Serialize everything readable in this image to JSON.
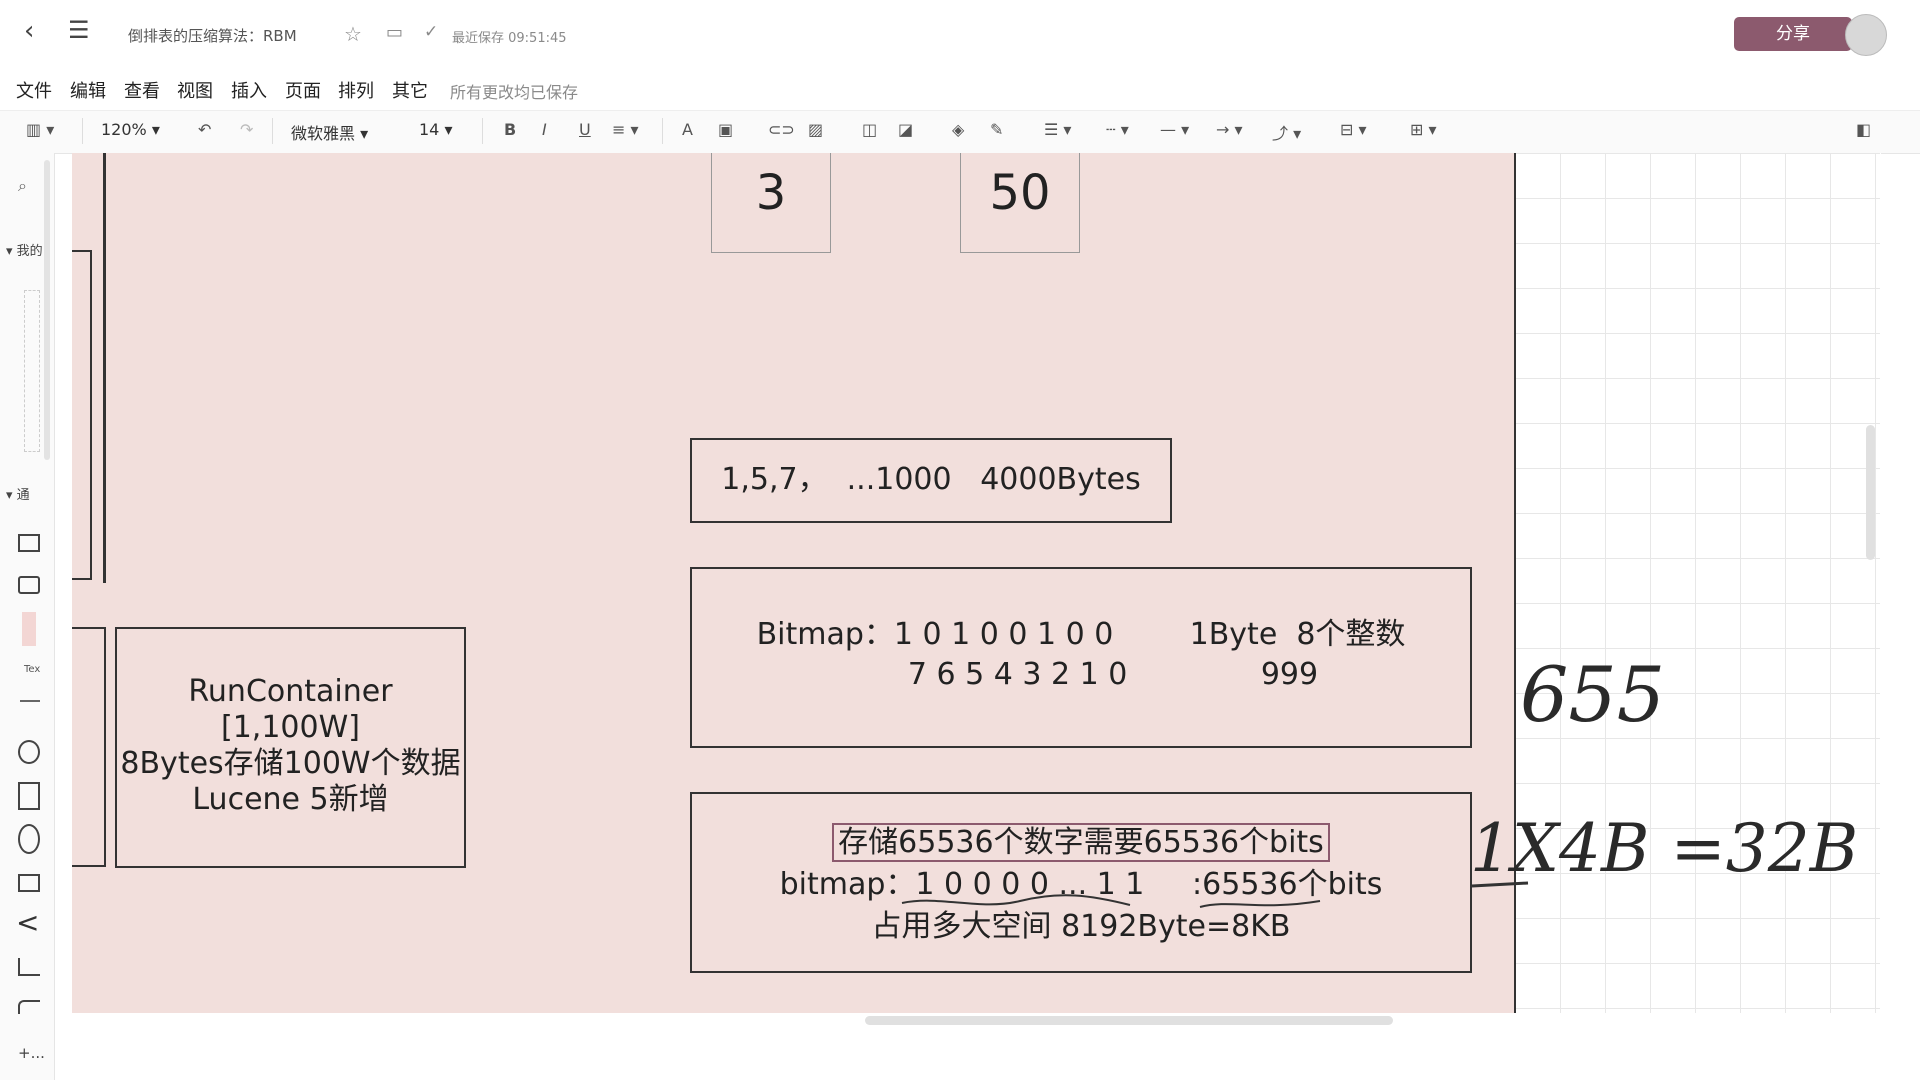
{
  "titlebar": {
    "doc_title": "倒排表的压缩算法：RBM",
    "save_status": "最近保存 09:51:45",
    "share_label": "分享"
  },
  "menu": {
    "items": [
      "文件",
      "编辑",
      "查看",
      "视图",
      "插入",
      "页面",
      "排列",
      "其它"
    ],
    "saved_note": "所有更改均已保存"
  },
  "toolbar": {
    "zoom": "120%",
    "font_family": "微软雅黑",
    "font_size": "14",
    "bold": "B",
    "italic": "I",
    "underline": "U",
    "font_color": "A"
  },
  "sidebar": {
    "section_mine": "我的",
    "section_general": "通",
    "text_tool": "Tex",
    "add_more": "+..."
  },
  "canvas": {
    "doc_shape_1": "3",
    "doc_shape_2": "50",
    "array_box": "1,5,7，  ...1000   4000Bytes",
    "bitmap_box": {
      "line1": "Bitmap：1 0 1 0 0 1 0 0        1Byte  8个整数",
      "line2": "7 6 5 4 3 2 1 0              999"
    },
    "storage_box": {
      "line1": "存储65536个数字需要65536个bits",
      "line2": "bitmap：1 0 0 0 0 ... 1 1     :65536个bits",
      "line3": "占用多大空间 8192Byte=8KB"
    },
    "run_container": {
      "line1": "RunContainer",
      "line2": "[1,100W]",
      "line3": "8Bytes存储100W个数据",
      "line4": "Lucene 5新增"
    },
    "handwriting_1": "655",
    "handwriting_2": "1X4B =32B"
  },
  "colors": {
    "page_bg": "#f2dfdc",
    "share_button": "#8c5a6e"
  }
}
